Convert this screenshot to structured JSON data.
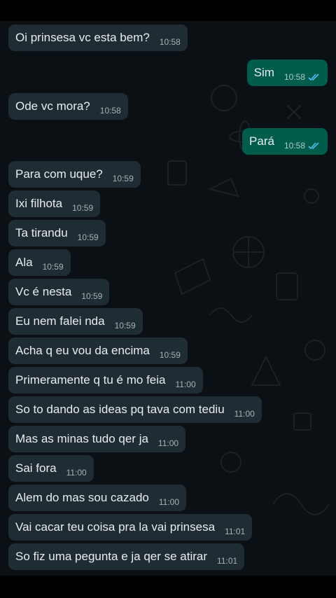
{
  "colors": {
    "background": "#0b1014",
    "incoming_bubble": "#1f2c33",
    "outgoing_bubble": "#005c4b",
    "read_tick": "#53bdeb"
  },
  "messages": [
    {
      "direction": "in",
      "text": "Oi prinsesa vc esta bem?",
      "time": "10:58"
    },
    {
      "direction": "out",
      "text": "Sim",
      "time": "10:58",
      "status_icon": "double-check-read-icon"
    },
    {
      "direction": "in",
      "text": "Ode vc mora?",
      "time": "10:58"
    },
    {
      "direction": "out",
      "text": "Pará",
      "time": "10:58",
      "status_icon": "double-check-read-icon"
    },
    {
      "direction": "in",
      "text": "Para com uque?",
      "time": "10:59"
    },
    {
      "direction": "in",
      "text": "Ixi filhota",
      "time": "10:59"
    },
    {
      "direction": "in",
      "text": "Ta tirandu",
      "time": "10:59"
    },
    {
      "direction": "in",
      "text": "Ala",
      "time": "10:59"
    },
    {
      "direction": "in",
      "text": "Vc é nesta",
      "time": "10:59"
    },
    {
      "direction": "in",
      "text": "Eu nem falei nda",
      "time": "10:59"
    },
    {
      "direction": "in",
      "text": "Acha q eu vou da encima",
      "time": "10:59"
    },
    {
      "direction": "in",
      "text": "Primeramente q tu é mo feia",
      "time": "11:00"
    },
    {
      "direction": "in",
      "text": "So to dando as ideas pq tava com tediu",
      "time": "11:00"
    },
    {
      "direction": "in",
      "text": "Mas as minas tudo qer ja",
      "time": "11:00"
    },
    {
      "direction": "in",
      "text": "Sai fora",
      "time": "11:00"
    },
    {
      "direction": "in",
      "text": "Alem do mas sou cazado",
      "time": "11:00"
    },
    {
      "direction": "in",
      "text": "Vai cacar teu coisa pra la vai prinsesa",
      "time": "11:01"
    },
    {
      "direction": "in",
      "text": "So fiz uma pegunta e ja qer se atirar",
      "time": "11:01"
    }
  ]
}
